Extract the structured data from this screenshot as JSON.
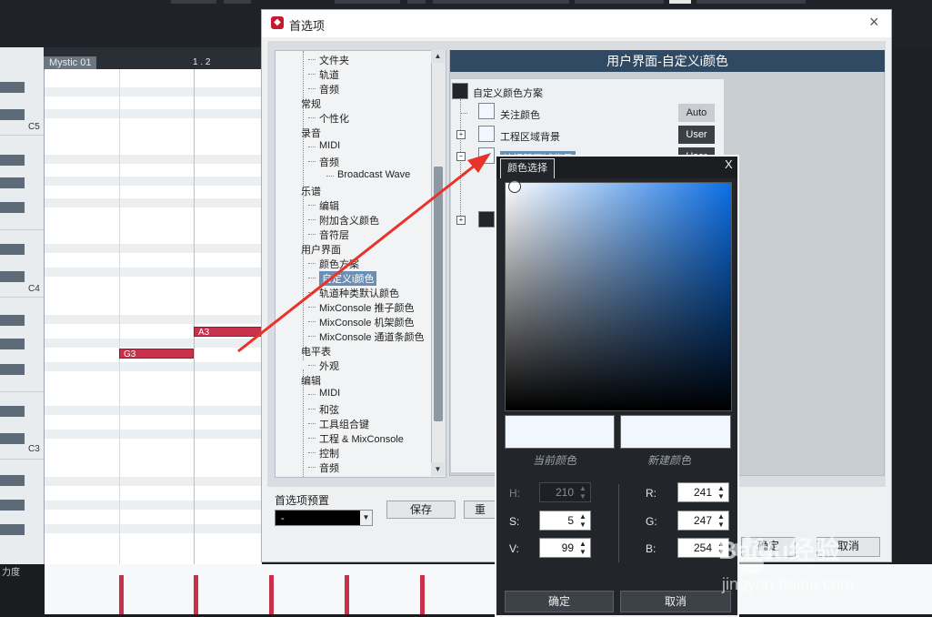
{
  "daw": {
    "clip_name": "Mystic 01",
    "ruler_position": "1 . 2",
    "key_labels": [
      "C5",
      "C4",
      "C3"
    ],
    "notes": [
      "A3",
      "G3"
    ],
    "velocity_label": "力度"
  },
  "prefs": {
    "title": "首选项",
    "close": "×",
    "tree": [
      {
        "label": "文件夹",
        "level": 2
      },
      {
        "label": "轨道",
        "level": 2
      },
      {
        "label": "音频",
        "level": 2
      },
      {
        "label": "常规",
        "level": 1
      },
      {
        "label": "个性化",
        "level": 2
      },
      {
        "label": "录音",
        "level": 1
      },
      {
        "label": "MIDI",
        "level": 2
      },
      {
        "label": "音频",
        "level": 2
      },
      {
        "label": "Broadcast Wave",
        "level": 3
      },
      {
        "label": "乐谱",
        "level": 1
      },
      {
        "label": "编辑",
        "level": 2
      },
      {
        "label": "附加含义颜色",
        "level": 2
      },
      {
        "label": "音符层",
        "level": 2
      },
      {
        "label": "用户界面",
        "level": 1
      },
      {
        "label": "颜色方案",
        "level": 2
      },
      {
        "label": "自定义i颜色",
        "level": 2,
        "selected": true
      },
      {
        "label": "轨道种类默认颜色",
        "level": 2
      },
      {
        "label": "MixConsole 推子颜色",
        "level": 2
      },
      {
        "label": "MixConsole 机架颜色",
        "level": 2
      },
      {
        "label": "MixConsole 通道条颜色",
        "level": 2
      },
      {
        "label": "电平表",
        "level": 1
      },
      {
        "label": "外观",
        "level": 2
      },
      {
        "label": "编辑",
        "level": 1
      },
      {
        "label": "MIDI",
        "level": 2
      },
      {
        "label": "和弦",
        "level": 2
      },
      {
        "label": "工具组合键",
        "level": 2
      },
      {
        "label": "工程 & MixConsole",
        "level": 2
      },
      {
        "label": "控制",
        "level": 2
      },
      {
        "label": "音频",
        "level": 2
      },
      {
        "label": "工具",
        "level": 2
      }
    ],
    "panel_title": "用户界面-自定义i颜色",
    "scheme_root": "自定义颜色方案",
    "scheme_items": [
      {
        "label": "关注颜色",
        "button": "Auto",
        "expander": ""
      },
      {
        "label": "工程区域背景",
        "button": "User",
        "expander": "+"
      },
      {
        "label": "编辑器区域背景",
        "button": "User",
        "expander": "−"
      }
    ],
    "preset_label": "首选项预置",
    "preset_value": "-",
    "save_button": "保存",
    "rename_button": "重",
    "ok_button": "确定",
    "cancel_button": "取消"
  },
  "color_picker": {
    "title": "颜色选择",
    "close": "X",
    "current_caption": "当前颜色",
    "new_caption": "新建颜色",
    "current_color": "#f1f7fe",
    "new_color": "#f1f7fe",
    "fields": {
      "H": {
        "label": "H:",
        "value": "210",
        "disabled": true
      },
      "S": {
        "label": "S:",
        "value": "5"
      },
      "V": {
        "label": "V:",
        "value": "99"
      },
      "R": {
        "label": "R:",
        "value": "241"
      },
      "G": {
        "label": "G:",
        "value": "247"
      },
      "B": {
        "label": "B:",
        "value": "254"
      }
    },
    "ok_button": "确定",
    "cancel_button": "取消"
  },
  "watermark": {
    "text": "Baidu经验",
    "subtext": "jingyan.baidu.com"
  },
  "colors": {
    "accent_red": "#e8322a",
    "note_red": "#c8324b",
    "header_blue": "#2f4a62"
  }
}
